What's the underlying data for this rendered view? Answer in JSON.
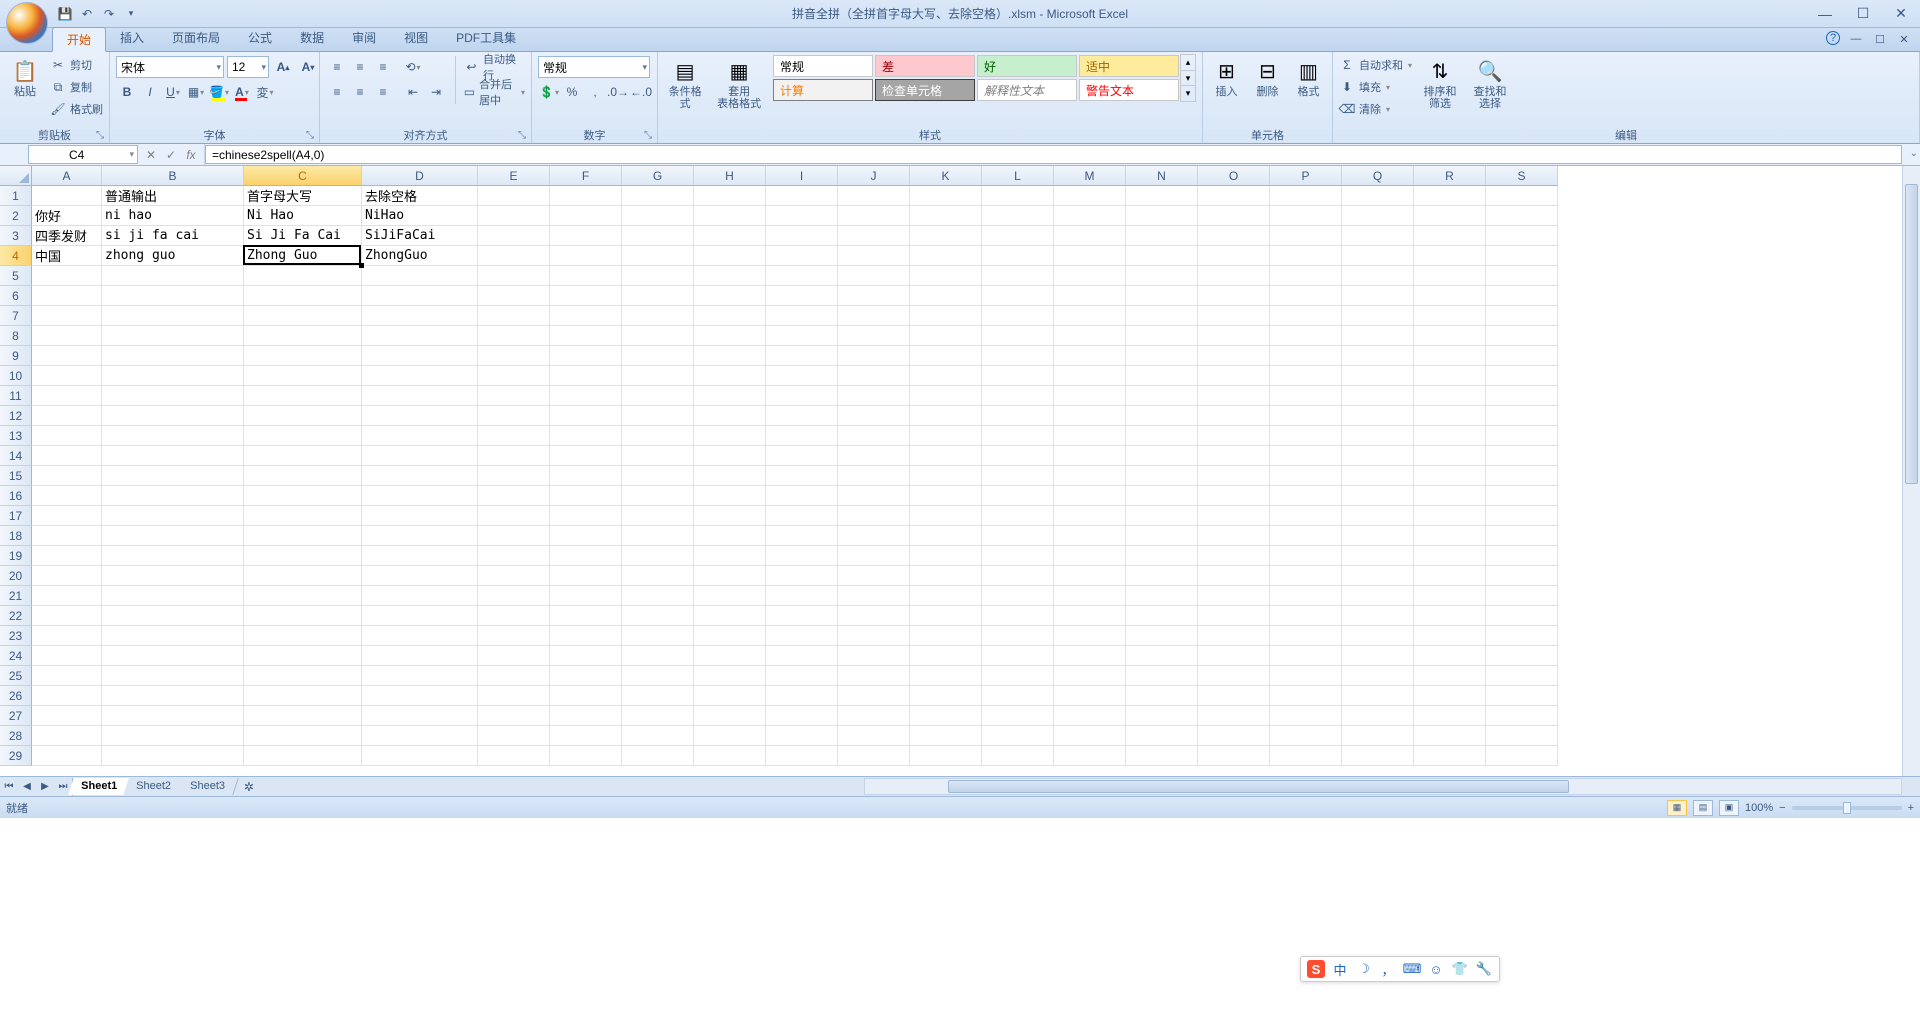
{
  "title": "拼音全拼（全拼首字母大写、去除空格）.xlsm - Microsoft Excel",
  "tabs": [
    "开始",
    "插入",
    "页面布局",
    "公式",
    "数据",
    "审阅",
    "视图",
    "PDF工具集"
  ],
  "activeTab": 0,
  "ribbon": {
    "clipboard": {
      "label": "剪贴板",
      "paste": "粘贴",
      "cut": "剪切",
      "copy": "复制",
      "painter": "格式刷"
    },
    "font": {
      "label": "字体",
      "name": "宋体",
      "size": "12"
    },
    "align": {
      "label": "对齐方式",
      "wrap": "自动换行",
      "merge": "合并后居中"
    },
    "number": {
      "label": "数字",
      "format": "常规"
    },
    "styles": {
      "label": "样式",
      "cond": "条件格式",
      "table": "套用\n表格格式",
      "cards": [
        {
          "t": "常规",
          "bg": "#ffffff",
          "fg": "#000",
          "bd": "#c8c8c8"
        },
        {
          "t": "差",
          "bg": "#ffc7ce",
          "fg": "#9c0006",
          "bd": "#c8c8c8"
        },
        {
          "t": "好",
          "bg": "#c6efce",
          "fg": "#006100",
          "bd": "#c8c8c8"
        },
        {
          "t": "适中",
          "bg": "#ffeb9c",
          "fg": "#9c6500",
          "bd": "#c8c8c8"
        },
        {
          "t": "计算",
          "bg": "#f2f2f2",
          "fg": "#fa7d00",
          "bd": "#7f7f7f"
        },
        {
          "t": "检查单元格",
          "bg": "#a5a5a5",
          "fg": "#ffffff",
          "bd": "#3f3f3f"
        },
        {
          "t": "解释性文本",
          "bg": "#ffffff",
          "fg": "#7f7f7f",
          "bd": "#c8c8c8",
          "it": true
        },
        {
          "t": "警告文本",
          "bg": "#ffffff",
          "fg": "#ff0000",
          "bd": "#c8c8c8"
        }
      ]
    },
    "cells": {
      "label": "单元格",
      "insert": "插入",
      "delete": "删除",
      "format": "格式"
    },
    "editing": {
      "label": "编辑",
      "sum": "自动求和",
      "fill": "填充",
      "clear": "清除",
      "sort": "排序和\n筛选",
      "find": "查找和\n选择"
    }
  },
  "namebox": "C4",
  "formula": "=chinese2spell(A4,0)",
  "columns": [
    "A",
    "B",
    "C",
    "D",
    "E",
    "F",
    "G",
    "H",
    "I",
    "J",
    "K",
    "L",
    "M",
    "N",
    "O",
    "P",
    "Q",
    "R",
    "S"
  ],
  "colWidths": {
    "A": 70,
    "B": 142,
    "C": 118,
    "D": 116,
    "default": 72
  },
  "selected": {
    "row": 4,
    "col": "C"
  },
  "rows": 29,
  "gridData": {
    "B1": "普通输出",
    "C1": "首字母大写",
    "D1": "去除空格",
    "A2": "你好",
    "B2": "ni hao",
    "C2": "Ni Hao",
    "D2": "NiHao",
    "A3": "四季发财",
    "B3": "si ji fa cai",
    "C3": "Si Ji Fa Cai",
    "D3": "SiJiFaCai",
    "A4": "中国",
    "B4": "zhong guo",
    "C4": "Zhong Guo",
    "D4": "ZhongGuo"
  },
  "sheets": [
    "Sheet1",
    "Sheet2",
    "Sheet3"
  ],
  "activeSheet": 0,
  "status": {
    "mode": "就绪",
    "zoom": "100%"
  }
}
